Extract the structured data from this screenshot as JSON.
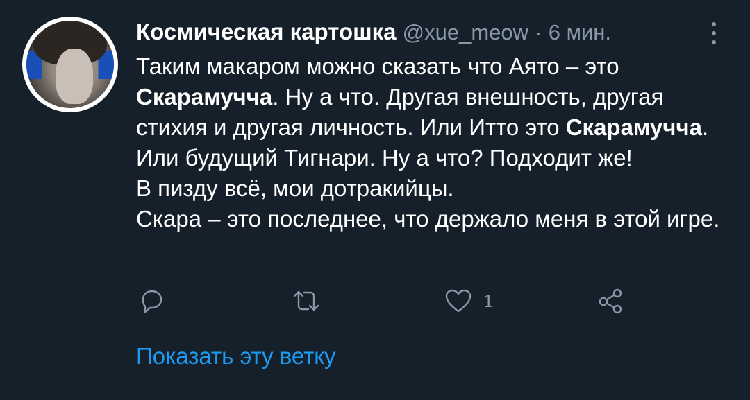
{
  "tweet": {
    "author_name": "Космическая картошка",
    "handle": "@xue_meow",
    "separator": "·",
    "time": "6 мин.",
    "text": {
      "p1": "Таким макаром можно сказать что Аято – это ",
      "b1": "Скарамучча",
      "p2": ". Ну а что. Другая внешность, другая стихия и другая личность. Или Итто это ",
      "b2": "Скарамучча",
      "p3": ".",
      "line2": "Или будущий Тигнари. Ну а что? Подходит же!",
      "line3": "В пизду всё, мои дотракийцы.",
      "line4": "Скара – это последнее, что держало меня в этой игре."
    },
    "like_count": "1",
    "show_thread": "Показать эту ветку"
  },
  "icons": {
    "reply": "reply-icon",
    "retweet": "retweet-icon",
    "like": "heart-icon",
    "share": "share-icon",
    "more": "more-vertical-icon"
  },
  "colors": {
    "background": "#15202b",
    "secondary_text": "#8899a6",
    "link": "#1d9bf0"
  }
}
